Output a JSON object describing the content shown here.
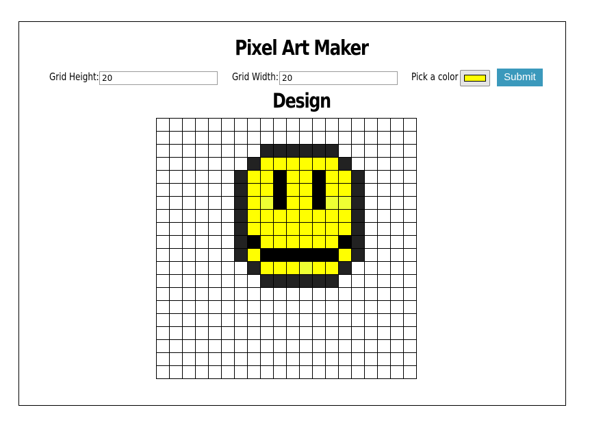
{
  "app": {
    "title": "Pixel Art Maker",
    "design_heading": "Design"
  },
  "form": {
    "height_label": "Grid Height:",
    "height_value": "20",
    "width_label": "Grid Width:",
    "width_value": "20",
    "color_label": "Pick a color",
    "color_value": "#ffff00",
    "submit_label": "Submit"
  },
  "colors": {
    "background": "#ffffff",
    "yellow": "#ffff00",
    "light_yellow": "#eeff33",
    "dark": "#222222",
    "black": "#000000",
    "submit": "#3b99bc"
  },
  "canvas": {
    "rows": 20,
    "cols": 20,
    "legend": {
      ".": "#ffffff",
      "Y": "#ffff00",
      "y": "#eeff33",
      "D": "#222222",
      "B": "#000000"
    },
    "pixels": [
      "....................",
      "....................",
      "........DDDDDD......",
      ".......DYYYYYYD.....",
      "......DYYBYYBYYD....",
      "......DYYBYYBYYD....",
      "......DYyBYYByyD....",
      "......DYYYYYYYYD....",
      "......DYYYYYYYYD....",
      "......DBYYYYYYBD....",
      "......DYBBBBBBYD....",
      ".......DYYYyYYD.....",
      "........DDDDDD......",
      "....................",
      "....................",
      "....................",
      "....................",
      "....................",
      "....................",
      "...................."
    ]
  }
}
